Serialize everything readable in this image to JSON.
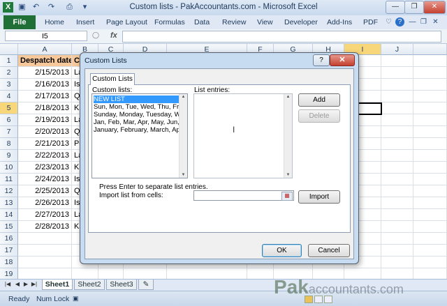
{
  "window": {
    "title": "Custom lists - PakAccountants.com  -  Microsoft Excel",
    "quick_access_icons": [
      "excel-logo-icon",
      "save-icon",
      "undo-icon",
      "redo-icon",
      "print-icon",
      "customize-icon"
    ],
    "controls": {
      "minimize": "—",
      "restore": "❐",
      "close": "✕"
    }
  },
  "ribbon": {
    "file_tab": "File",
    "tabs": [
      "Home",
      "Insert",
      "Page Layout",
      "Formulas",
      "Data",
      "Review",
      "View",
      "Developer",
      "Add-Ins",
      "PDF"
    ]
  },
  "formula_bar": {
    "name_box": "I5",
    "fx_label": "fx",
    "value": ""
  },
  "grid": {
    "columns": [
      "A",
      "B",
      "C",
      "D",
      "E",
      "F",
      "G",
      "H",
      "I",
      "J"
    ],
    "selected_column": "I",
    "selected_row": "5",
    "rows": [
      {
        "n": "1",
        "a": "Despatch date",
        "b": "Cu"
      },
      {
        "n": "2",
        "a": "2/15/2013",
        "b": "La"
      },
      {
        "n": "3",
        "a": "2/16/2013",
        "b": "Is"
      },
      {
        "n": "4",
        "a": "2/17/2013",
        "b": "Qu"
      },
      {
        "n": "5",
        "a": "2/18/2013",
        "b": "Ka"
      },
      {
        "n": "6",
        "a": "2/19/2013",
        "b": "La"
      },
      {
        "n": "7",
        "a": "2/20/2013",
        "b": "Qu"
      },
      {
        "n": "8",
        "a": "2/21/2013",
        "b": "Pe"
      },
      {
        "n": "9",
        "a": "2/22/2013",
        "b": "La"
      },
      {
        "n": "10",
        "a": "2/23/2013",
        "b": "Ka"
      },
      {
        "n": "11",
        "a": "2/24/2013",
        "b": "Is"
      },
      {
        "n": "12",
        "a": "2/25/2013",
        "b": "Qu"
      },
      {
        "n": "13",
        "a": "2/26/2013",
        "b": "Is"
      },
      {
        "n": "14",
        "a": "2/27/2013",
        "b": "La"
      },
      {
        "n": "15",
        "a": "2/28/2013",
        "b": "Ka"
      },
      {
        "n": "16",
        "a": "",
        "b": ""
      },
      {
        "n": "17",
        "a": "",
        "b": ""
      },
      {
        "n": "18",
        "a": "",
        "b": ""
      },
      {
        "n": "19",
        "a": "",
        "b": ""
      }
    ]
  },
  "sheets": {
    "tabs": [
      "Sheet1",
      "Sheet2",
      "Sheet3"
    ],
    "active": "Sheet1"
  },
  "status": {
    "ready": "Ready",
    "num_lock": "Num Lock"
  },
  "dialog": {
    "title": "Custom Lists",
    "help": "?",
    "close": "✕",
    "tab": "Custom Lists",
    "custom_lists_label": "Custom lists:",
    "list_entries_label": "List entries:",
    "lists": [
      "NEW LIST",
      "Sun, Mon, Tue, Wed, Thu, Fri, S",
      "Sunday, Monday, Tuesday, Wed",
      "Jan, Feb, Mar, Apr, May, Jun, J",
      "January, February, March, April"
    ],
    "add_button": "Add",
    "delete_button": "Delete",
    "hint": "Press Enter to separate list entries.",
    "import_label": "Import list from cells:",
    "import_value": "",
    "import_button": "Import",
    "ok_button": "OK",
    "cancel_button": "Cancel"
  },
  "watermark": {
    "brand": "Pak",
    "rest": "accountants.com"
  }
}
